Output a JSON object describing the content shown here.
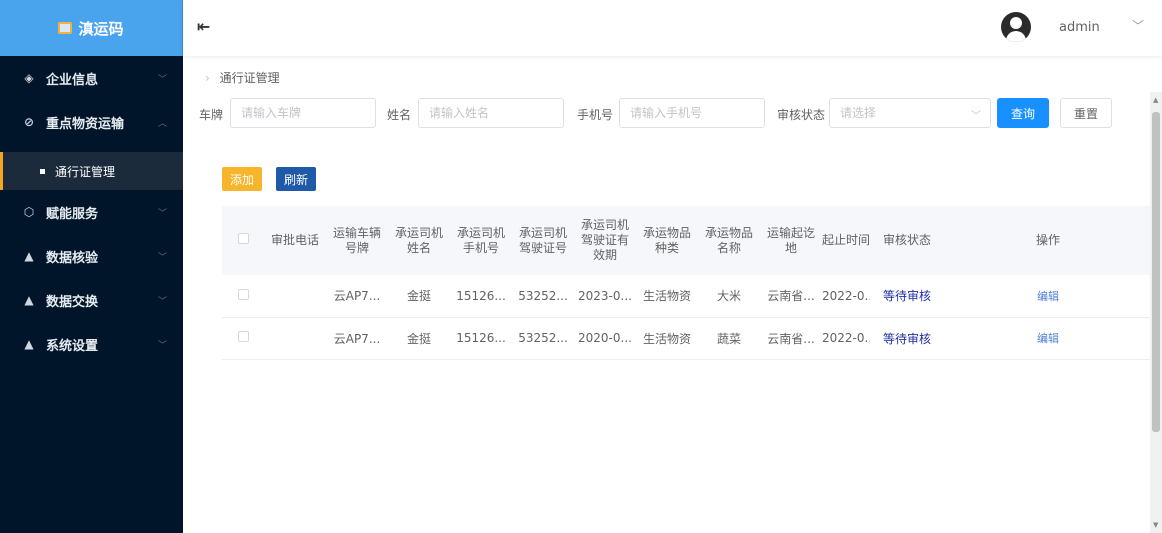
{
  "sidebar": {
    "brand": "滇运码",
    "menu": [
      {
        "icon": "layers-icon",
        "glyph": "◈",
        "label": "企业信息"
      },
      {
        "icon": "link-icon",
        "glyph": "⊘",
        "label": "重点物资运输"
      },
      {
        "sub_label": "通行证管理"
      },
      {
        "icon": "cube-icon",
        "glyph": "⬡",
        "label": "赋能服务"
      },
      {
        "icon": "badge-icon",
        "glyph": "▲",
        "label": "数据核验"
      },
      {
        "icon": "badge-icon",
        "glyph": "▲",
        "label": "数据交换"
      },
      {
        "icon": "badge-icon",
        "glyph": "▲",
        "label": "系统设置"
      }
    ]
  },
  "header": {
    "user": "admin"
  },
  "breadcrumb": {
    "current": "通行证管理"
  },
  "filters": {
    "plate_label": "车牌",
    "plate_placeholder": "请输入车牌",
    "name_label": "姓名",
    "name_placeholder": "请输入姓名",
    "phone_label": "手机号",
    "phone_placeholder": "请输入手机号",
    "status_label": "审核状态",
    "status_placeholder": "请选择",
    "query_label": "查询",
    "reset_label": "重置"
  },
  "actions": {
    "add_label": "添加",
    "refresh_label": "刷新"
  },
  "table": {
    "headers": [
      "审批电话",
      "运输车辆号牌",
      "承运司机姓名",
      "承运司机手机号",
      "承运司机驾驶证号",
      "承运司机驾驶证有效期",
      "承运物品种类",
      "承运物品名称",
      "运输起讫地",
      "起止时间",
      "审核状态",
      "操作"
    ],
    "rows": [
      {
        "phone": "",
        "plate": "云AP7...",
        "driver": "金挺",
        "mobile": "15126...",
        "license": "53252...",
        "license_exp": "2023-0...",
        "category": "生活物资",
        "item": "大米",
        "route": "云南省...",
        "period": "2022-0...",
        "status": "等待审核",
        "op": "编辑"
      },
      {
        "phone": "",
        "plate": "云AP7...",
        "driver": "金挺",
        "mobile": "15126...",
        "license": "53252...",
        "license_exp": "2020-0...",
        "category": "生活物资",
        "item": "蔬菜",
        "route": "云南省...",
        "period": "2022-0...",
        "status": "等待审核",
        "op": "编辑"
      }
    ]
  }
}
